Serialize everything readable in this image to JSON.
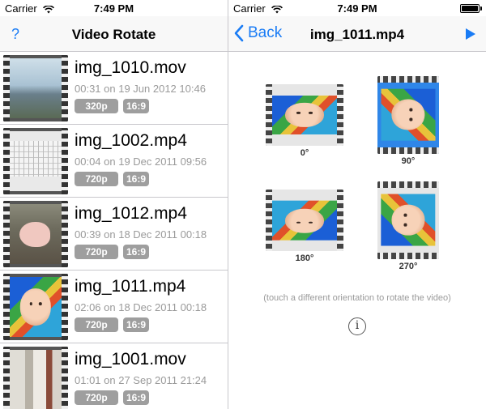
{
  "status_left": {
    "carrier": "Carrier",
    "time": "7:49 PM"
  },
  "status_right": {
    "carrier": "Carrier",
    "time": "7:49 PM"
  },
  "left_nav": {
    "help_label": "?",
    "title": "Video Rotate"
  },
  "right_nav": {
    "back_label": "Back",
    "title": "img_1011.mp4"
  },
  "videos": [
    {
      "name": "img_1010.mov",
      "meta": "00:31 on 19 Jun 2012 10:46",
      "resolution": "320p",
      "aspect": "16:9",
      "thumb": "sky"
    },
    {
      "name": "img_1002.mp4",
      "meta": "00:04 on 19 Dec 2011 09:56",
      "resolution": "720p",
      "aspect": "16:9",
      "thumb": "keyboard"
    },
    {
      "name": "img_1012.mp4",
      "meta": "00:39 on 18 Dec 2011 00:18",
      "resolution": "720p",
      "aspect": "16:9",
      "thumb": "pig"
    },
    {
      "name": "img_1011.mp4",
      "meta": "02:06 on 18 Dec 2011 00:18",
      "resolution": "720p",
      "aspect": "16:9",
      "thumb": "baby"
    },
    {
      "name": "img_1001.mov",
      "meta": "01:01 on 27 Sep 2011 21:24",
      "resolution": "720p",
      "aspect": "16:9",
      "thumb": "room"
    }
  ],
  "rotations": [
    {
      "label": "0°",
      "selected": false
    },
    {
      "label": "90°",
      "selected": true
    },
    {
      "label": "180°",
      "selected": false
    },
    {
      "label": "270°",
      "selected": false
    }
  ],
  "hint": "(touch a different orientation to rotate the video)",
  "info_label": "i",
  "colors": {
    "accent": "#1a7cf5",
    "badge": "#9e9e9e",
    "selected": "#2f86e8"
  },
  "icons": {
    "wifi": "wifi-icon",
    "battery": "battery-icon",
    "back": "chevron-left-icon",
    "play": "play-icon",
    "info": "info-icon"
  }
}
